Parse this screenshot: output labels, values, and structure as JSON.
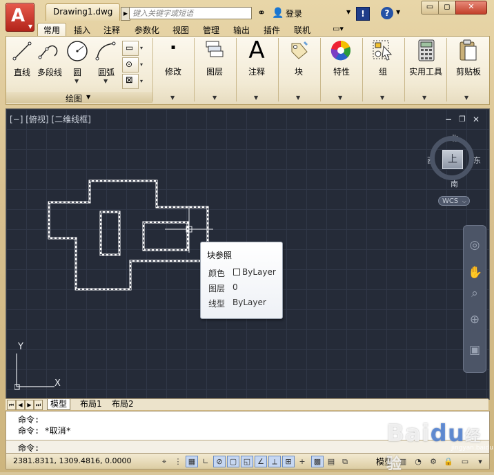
{
  "window": {
    "document_tab": "Drawing1.dwg",
    "search_placeholder": "键入关键字或短语",
    "login_label": "登录",
    "help_topic": "!",
    "help": "?",
    "min_glyph": "▭",
    "max_glyph": "◻",
    "close_glyph": "✕",
    "app_logo": "A",
    "accent_color": "#c0392b"
  },
  "ribbon": {
    "tabs": [
      "常用",
      "插入",
      "注释",
      "参数化",
      "视图",
      "管理",
      "输出",
      "插件",
      "联机"
    ],
    "active_tab": "常用",
    "draw_tools": [
      {
        "label": "直线",
        "icon": "line-icon"
      },
      {
        "label": "多段线",
        "icon": "polyline-icon"
      },
      {
        "label": "圆",
        "icon": "circle-icon"
      },
      {
        "label": "圆弧",
        "icon": "arc-icon"
      }
    ],
    "draw_panel_title": "绘图",
    "panels": [
      {
        "label": "修改",
        "icon": "modify-icon"
      },
      {
        "label": "图层",
        "icon": "layer-icon"
      },
      {
        "label": "注释",
        "icon": "annotation-icon"
      },
      {
        "label": "块",
        "icon": "block-icon"
      },
      {
        "label": "特性",
        "icon": "properties-icon"
      },
      {
        "label": "组",
        "icon": "group-icon"
      },
      {
        "label": "实用工具",
        "icon": "calculator-icon"
      },
      {
        "label": "剪贴板",
        "icon": "clipboard-icon"
      }
    ]
  },
  "viewport": {
    "view_label": "[−] [俯视] [二维线框]",
    "compass": {
      "north": "北",
      "south": "南",
      "east": "东",
      "west": "西",
      "cube": "上"
    },
    "wcs_label": "WCS",
    "ucs": {
      "x": "X",
      "y": "Y"
    },
    "ctrl": {
      "min": "−",
      "restore": "❐",
      "close": "✕"
    }
  },
  "tooltip": {
    "title": "块参照",
    "rows": [
      {
        "key": "颜色",
        "value": "ByLayer"
      },
      {
        "key": "图层",
        "value": "0"
      },
      {
        "key": "线型",
        "value": "ByLayer"
      }
    ]
  },
  "layout_tabs": [
    "模型",
    "布局1",
    "布局2"
  ],
  "command": {
    "history": [
      "命令:",
      "命令: *取消*"
    ],
    "prompt": "命令:"
  },
  "status": {
    "coordinates": "2381.8311, 1309.4816, 0.0000",
    "model_label": "模型"
  },
  "watermark": {
    "text": "Bai",
    "paw": "du",
    "suffix": "经验",
    "sub": "jingyan.baidu.com"
  }
}
